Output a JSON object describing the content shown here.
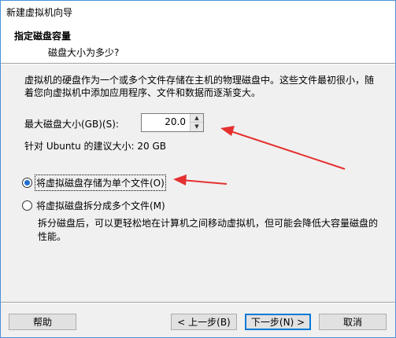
{
  "window": {
    "title": "新建虚拟机向导"
  },
  "header": {
    "title": "指定磁盘容量",
    "subtitle": "磁盘大小为多少?"
  },
  "main": {
    "description": "虚拟机的硬盘作为一个或多个文件存储在主机的物理磁盘中。这些文件最初很小，随着您向虚拟机中添加应用程序、文件和数据而逐渐变大。",
    "size_label": "最大磁盘大小(GB)(S):",
    "size_value": "20.0",
    "recommend": "针对 Ubuntu 的建议大小: 20 GB",
    "option_single": "将虚拟磁盘存储为单个文件(O)",
    "option_split": "将虚拟磁盘拆分成多个文件(M)",
    "split_description": "拆分磁盘后，可以更轻松地在计算机之间移动虚拟机，但可能会降低大容量磁盘的性能。",
    "selected_option": "single"
  },
  "footer": {
    "help_label": "帮助",
    "back_label": "< 上一步(B)",
    "next_label": "下一步(N) >",
    "cancel_label": "取消"
  },
  "colors": {
    "annotation_arrow": "#e53030",
    "radio_selected": "#1f6fd1"
  }
}
